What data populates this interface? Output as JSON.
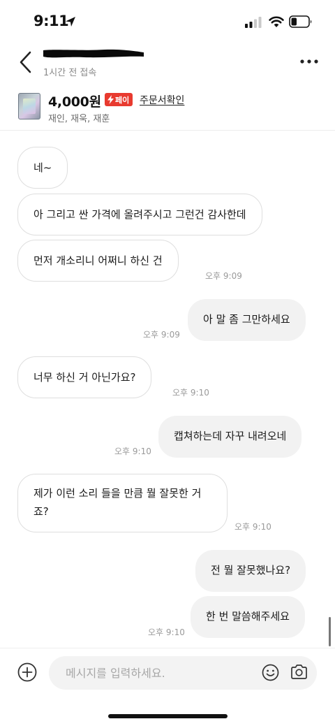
{
  "status_bar": {
    "time": "9:11",
    "icons": [
      "location-arrow-icon",
      "cellular-signal-icon",
      "wifi-icon",
      "battery-icon"
    ]
  },
  "header": {
    "back_icon": "chevron-left-icon",
    "name": "",
    "last_seen": "1시간 전 접속",
    "more_icon": "more-horizontal-icon"
  },
  "product": {
    "price": "4,000원",
    "pay_badge": "페이",
    "order_link": "주문서확인",
    "subtitle": "재인, 재욱, 재훈"
  },
  "messages": [
    {
      "side": "in",
      "text": "네~",
      "time": ""
    },
    {
      "side": "in",
      "text": "아 그리고 싼 가격에 올려주시고 그런건 감사한데",
      "time": ""
    },
    {
      "side": "in",
      "text": "먼저 개소리니 어쩌니 하신 건",
      "time": "오후 9:09"
    },
    {
      "side": "out",
      "text": "아 말 좀 그만하세요",
      "time": "오후 9:09"
    },
    {
      "side": "in",
      "text": "너무 하신 거 아닌가요?",
      "time": "오후 9:10"
    },
    {
      "side": "out",
      "text": "캡쳐하는데 자꾸 내려오네",
      "time": "오후 9:10"
    },
    {
      "side": "in",
      "text": "제가 이런 소리 들을 만큼 뭘 잘못한 거죠?",
      "time": "오후 9:10"
    },
    {
      "side": "out",
      "text": "전 뭘 잘못했나요?",
      "time": ""
    },
    {
      "side": "out",
      "text": "한 번 말씀해주세요",
      "time": "오후 9:10"
    }
  ],
  "composer": {
    "placeholder": "메시지를 입력하세요.",
    "add_icon": "plus-circle-icon",
    "emoji_icon": "smiley-icon",
    "camera_icon": "camera-icon"
  },
  "colors": {
    "pay_badge": "#e83a2f",
    "outgoing_bubble": "#f2f2f2",
    "incoming_border": "#dedede",
    "timestamp": "#9a9a9a"
  }
}
